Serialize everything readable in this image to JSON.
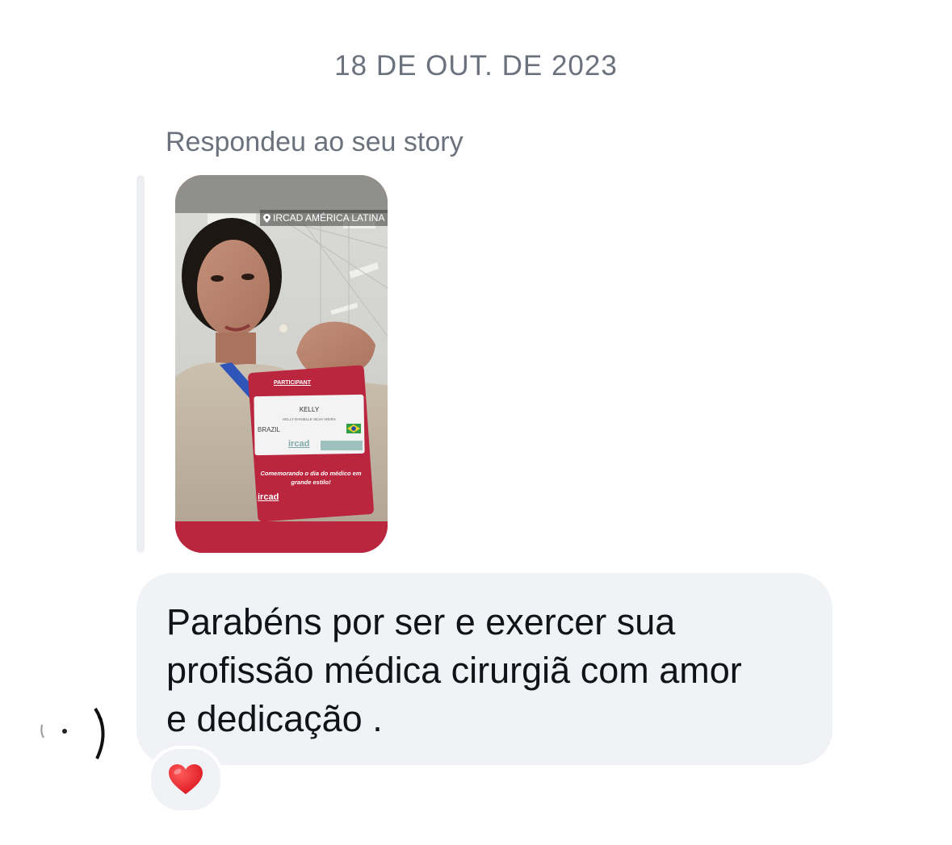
{
  "conversation": {
    "date_separator": "18 DE OUT. DE 2023",
    "reply_context_label": "Respondeu ao seu story"
  },
  "story_preview": {
    "location_sticker": "IRCAD AMÉRICA LATINA",
    "location_icon": "location-pin-icon",
    "badge": {
      "header": "PARTICIPANT",
      "first_name": "KELLY",
      "full_name": "KELLY DANIELLE SILVA VIEIRA",
      "country": "BRAZIL",
      "logo_text": "ircad",
      "caption": "Comemorando o dia do médico em grande estilo!",
      "caption_logo": "ircad"
    },
    "colors": {
      "badge_red": "#b9263d",
      "frame_red": "#b9263d"
    }
  },
  "message": {
    "text": "Parabéns por ser e exercer sua\nprofissão médica cirurgiã com amor\ne dedicação .",
    "bubble_color": "#f1f2f5",
    "text_color": "#101419"
  },
  "reaction": {
    "emoji": "❤️",
    "icon": "red-heart-icon"
  },
  "sender": {
    "avatar_icon": "avatar"
  }
}
